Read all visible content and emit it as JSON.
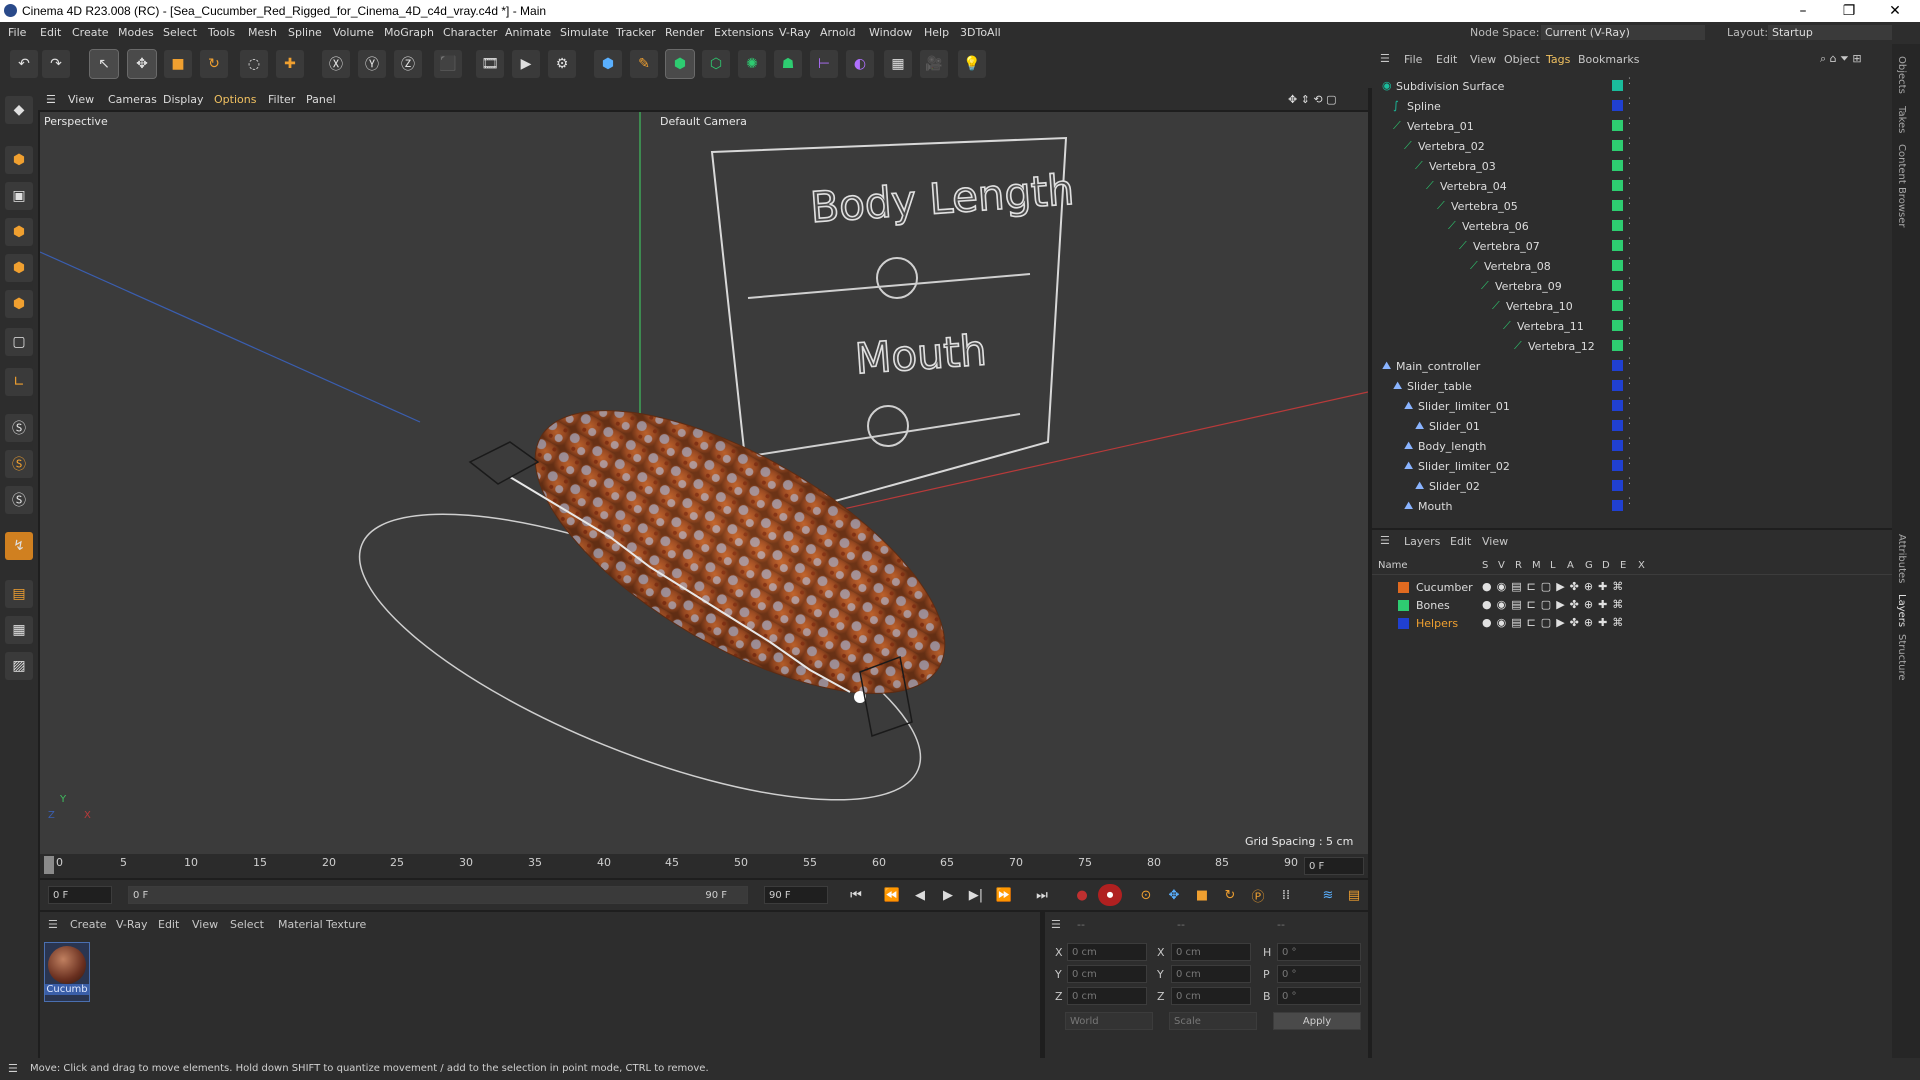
{
  "window": {
    "title": "Cinema 4D R23.008 (RC) - [Sea_Cucumber_Red_Rigged_for_Cinema_4D_c4d_vray.c4d *] - Main",
    "controls": [
      "–",
      "❐",
      "✕"
    ]
  },
  "menubar": {
    "items": [
      "File",
      "Edit",
      "Create",
      "Modes",
      "Select",
      "Tools",
      "Mesh",
      "Spline",
      "Volume",
      "MoGraph",
      "Character",
      "Animate",
      "Simulate",
      "Tracker",
      "Render",
      "Extensions",
      "V-Ray",
      "Arnold",
      "Window",
      "Help",
      "3DToAll"
    ],
    "node_space_label": "Node Space:",
    "node_space_value": "Current (V-Ray)",
    "layout_label": "Layout:",
    "layout_value": "Startup"
  },
  "toolbar": {
    "icons": [
      "undo-icon",
      "redo-icon",
      "select-icon",
      "move-icon",
      "scale-icon",
      "rotate-icon",
      "recent-icon",
      "add-icon",
      "x-axis-icon",
      "y-axis-icon",
      "z-axis-icon",
      "coord-system-icon",
      "render-region-icon",
      "render-view-icon",
      "render-settings-icon",
      "cube-icon",
      "pen-icon",
      "subdivision-icon",
      "extrude-icon",
      "cloner-icon",
      "mograph-icon",
      "deformer-icon",
      "field-icon",
      "floor-icon",
      "camera-icon",
      "light-icon"
    ]
  },
  "viewport_menu": {
    "items": [
      "View",
      "Cameras",
      "Display",
      "Options",
      "Filter",
      "Panel"
    ],
    "label": "Perspective",
    "camera": "Default Camera",
    "grid_spacing": "Grid Spacing : 5 cm",
    "billboard_title": "Body Length",
    "billboard_mouth": "Mouth"
  },
  "timeline": {
    "ticks": [
      "0",
      "5",
      "10",
      "15",
      "20",
      "25",
      "30",
      "35",
      "40",
      "45",
      "50",
      "55",
      "60",
      "65",
      "70",
      "75",
      "80",
      "85",
      "90"
    ],
    "current_frame": "0 F"
  },
  "playbar": {
    "start_field": "0 F",
    "range_start": "0 F",
    "range_end": "90 F",
    "end_field": "90 F"
  },
  "material_panel": {
    "menu": [
      "Create",
      "V-Ray",
      "Edit",
      "View",
      "Select",
      "Material",
      "Texture"
    ],
    "material_name": "Cucumb"
  },
  "coordinates": {
    "rows": [
      {
        "a": "X",
        "av": "0 cm",
        "b": "X",
        "bv": "0 cm",
        "c": "H",
        "cv": "0 °"
      },
      {
        "a": "Y",
        "av": "0 cm",
        "b": "Y",
        "bv": "0 cm",
        "c": "P",
        "cv": "0 °"
      },
      {
        "a": "Z",
        "av": "0 cm",
        "b": "Z",
        "bv": "0 cm",
        "c": "B",
        "cv": "0 °"
      }
    ],
    "header": [
      "--",
      "--",
      "--"
    ],
    "mode1": "World",
    "mode2": "Scale",
    "apply": "Apply"
  },
  "object_manager": {
    "menu": [
      "File",
      "Edit",
      "View",
      "Object",
      "Tags",
      "Bookmarks"
    ],
    "objects": [
      {
        "name": "Subdivision Surface",
        "indent": 0,
        "color": "#1abc9c",
        "icon": "subdivision-icon"
      },
      {
        "name": "Spline",
        "indent": 1,
        "color": "#2040d0",
        "icon": "spline-icon"
      },
      {
        "name": "Vertebra_01",
        "indent": 1,
        "color": "#2ecc71",
        "icon": "bone-icon"
      },
      {
        "name": "Vertebra_02",
        "indent": 2,
        "color": "#2ecc71",
        "icon": "bone-icon"
      },
      {
        "name": "Vertebra_03",
        "indent": 3,
        "color": "#2ecc71",
        "icon": "bone-icon"
      },
      {
        "name": "Vertebra_04",
        "indent": 4,
        "color": "#2ecc71",
        "icon": "bone-icon"
      },
      {
        "name": "Vertebra_05",
        "indent": 5,
        "color": "#2ecc71",
        "icon": "bone-icon"
      },
      {
        "name": "Vertebra_06",
        "indent": 6,
        "color": "#2ecc71",
        "icon": "bone-icon"
      },
      {
        "name": "Vertebra_07",
        "indent": 7,
        "color": "#2ecc71",
        "icon": "bone-icon"
      },
      {
        "name": "Vertebra_08",
        "indent": 8,
        "color": "#2ecc71",
        "icon": "bone-icon"
      },
      {
        "name": "Vertebra_09",
        "indent": 9,
        "color": "#2ecc71",
        "icon": "bone-icon"
      },
      {
        "name": "Vertebra_10",
        "indent": 10,
        "color": "#2ecc71",
        "icon": "bone-icon"
      },
      {
        "name": "Vertebra_11",
        "indent": 11,
        "color": "#2ecc71",
        "icon": "bone-icon"
      },
      {
        "name": "Vertebra_12",
        "indent": 12,
        "color": "#2ecc71",
        "icon": "bone-icon"
      },
      {
        "name": "Main_controller",
        "indent": 0,
        "color": "#2040d0",
        "icon": "null-icon"
      },
      {
        "name": "Slider_table",
        "indent": 1,
        "color": "#2040d0",
        "icon": "null-icon"
      },
      {
        "name": "Slider_limiter_01",
        "indent": 2,
        "color": "#2040d0",
        "icon": "null-icon"
      },
      {
        "name": "Slider_01",
        "indent": 3,
        "color": "#2040d0",
        "icon": "null-icon"
      },
      {
        "name": "Body_length",
        "indent": 2,
        "color": "#2040d0",
        "icon": "null-icon"
      },
      {
        "name": "Slider_limiter_02",
        "indent": 2,
        "color": "#2040d0",
        "icon": "null-icon"
      },
      {
        "name": "Slider_02",
        "indent": 3,
        "color": "#2040d0",
        "icon": "null-icon"
      },
      {
        "name": "Mouth",
        "indent": 2,
        "color": "#2040d0",
        "icon": "null-icon"
      }
    ]
  },
  "layer_manager": {
    "menu": [
      "Layers",
      "Edit",
      "View"
    ],
    "columns": [
      "Name",
      "S",
      "V",
      "R",
      "M",
      "L",
      "A",
      "G",
      "D",
      "E",
      "X"
    ],
    "layers": [
      {
        "name": "Cucumber",
        "color": "#e06a20"
      },
      {
        "name": "Bones",
        "color": "#2ecc71"
      },
      {
        "name": "Helpers",
        "color": "#2040d0"
      }
    ]
  },
  "side_tabs": [
    "Objects",
    "Takes",
    "Content Browser",
    "Attributes",
    "Layers",
    "Structure"
  ],
  "status": "Move: Click and drag to move elements. Hold down SHIFT to quantize movement / add to the selection in point mode, CTRL to remove."
}
